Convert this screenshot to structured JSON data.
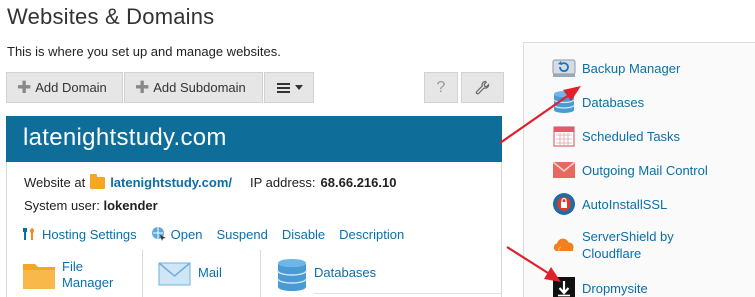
{
  "page": {
    "title": "Websites & Domains",
    "description": "This is where you set up and manage websites."
  },
  "toolbar": {
    "add_domain": "Add Domain",
    "add_subdomain": "Add Subdomain",
    "menu_icon": "hamburger-icon",
    "help_icon": "question-icon",
    "tools_icon": "wrench-icon"
  },
  "domain": {
    "name": "latenightstudy.com",
    "website_label": "Website at",
    "website_link": "latenightstudy.com/",
    "ip_label": "IP address:",
    "ip_value": "68.66.216.10",
    "user_label": "System user:",
    "user_value": "lokender",
    "actions": [
      "Hosting Settings",
      "Open",
      "Suspend",
      "Disable",
      "Description"
    ],
    "tiles": [
      "File Manager",
      "Mail",
      "Databases"
    ]
  },
  "sidebar": {
    "items": [
      {
        "label": "Backup Manager",
        "icon": "backup-icon"
      },
      {
        "label": "Databases",
        "icon": "database-icon"
      },
      {
        "label": "Scheduled Tasks",
        "icon": "calendar-icon"
      },
      {
        "label": "Outgoing Mail Control",
        "icon": "mail-envelope-icon"
      },
      {
        "label": "AutoInstallSSL",
        "icon": "ssl-icon"
      },
      {
        "label": "ServerShield by Cloudflare",
        "icon": "cloudflare-icon"
      },
      {
        "label": "Dropmysite",
        "icon": "dropmysite-icon"
      }
    ]
  },
  "colors": {
    "header_bg": "#0f6e99",
    "link": "#0a6fa8",
    "annotation_arrow": "#e0202a"
  }
}
